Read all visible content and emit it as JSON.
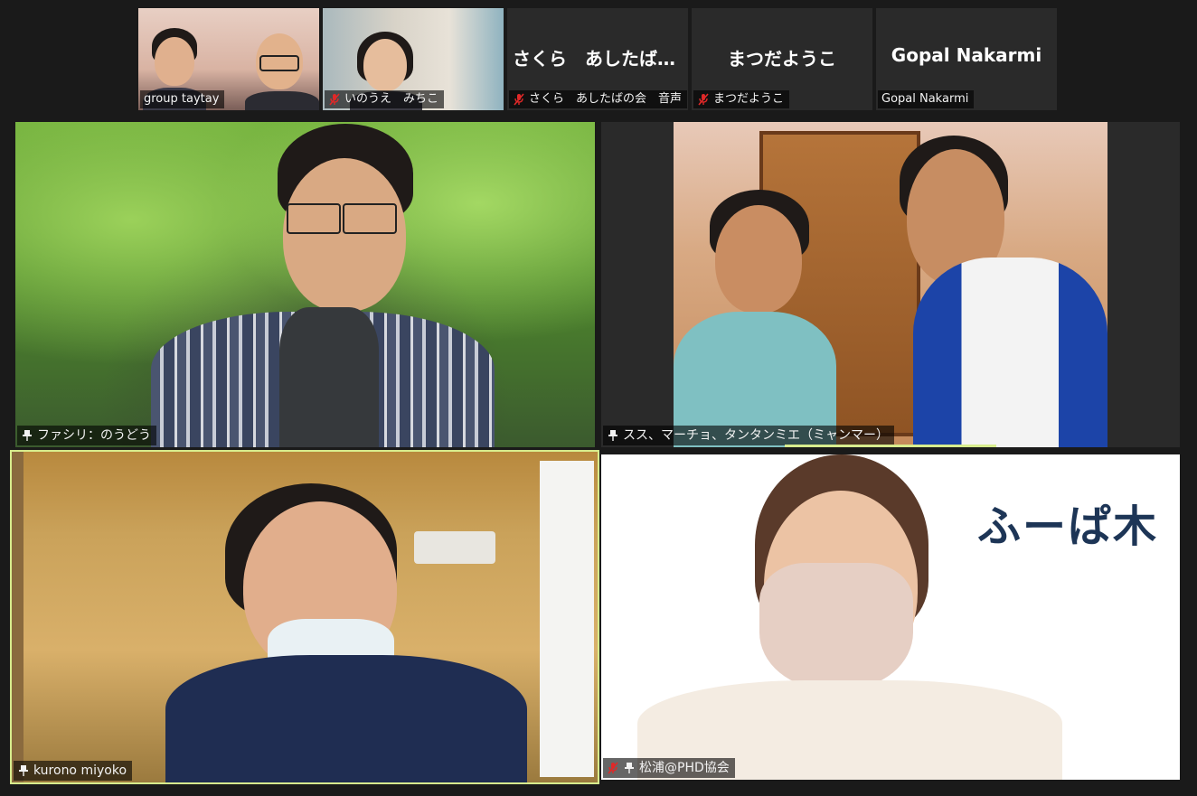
{
  "app": "Zoom gallery view",
  "colors": {
    "background": "#1a1a1a",
    "tile": "#232323",
    "active_speaker_border": "#d7ec8d",
    "muted_icon": "#e02828",
    "logo_text": "#1d3556"
  },
  "top_row": [
    {
      "name": "group taytay",
      "muted": false,
      "pinned": false,
      "video": true
    },
    {
      "name": "いのうえ　みちこ",
      "muted": true,
      "pinned": false,
      "video": true
    },
    {
      "display_name": "さくら　あしたばの...",
      "name": "さくら　あしたばの会　音声",
      "muted": true,
      "pinned": false,
      "video": false
    },
    {
      "display_name": "まつだようこ",
      "name": "まつだようこ",
      "muted": true,
      "pinned": false,
      "video": false
    },
    {
      "display_name": "Gopal Nakarmi",
      "name": "Gopal Nakarmi",
      "muted": false,
      "pinned": false,
      "video": false
    }
  ],
  "main_grid": [
    {
      "name": "ファシリ：のうどう",
      "pinned": true,
      "muted": false,
      "active": false
    },
    {
      "name": "スス、マーチョ、タンタンミエ（ミャンマー）",
      "pinned": true,
      "muted": false,
      "active": false
    },
    {
      "name": "kurono miyoko",
      "pinned": true,
      "muted": false,
      "active": true
    },
    {
      "name": "松浦@PHD協会",
      "pinned": true,
      "muted": true,
      "active": false,
      "sign_text": "ふーぱ木"
    }
  ],
  "icons": {
    "pin": "pin-icon",
    "muted_mic": "muted-mic-icon"
  }
}
